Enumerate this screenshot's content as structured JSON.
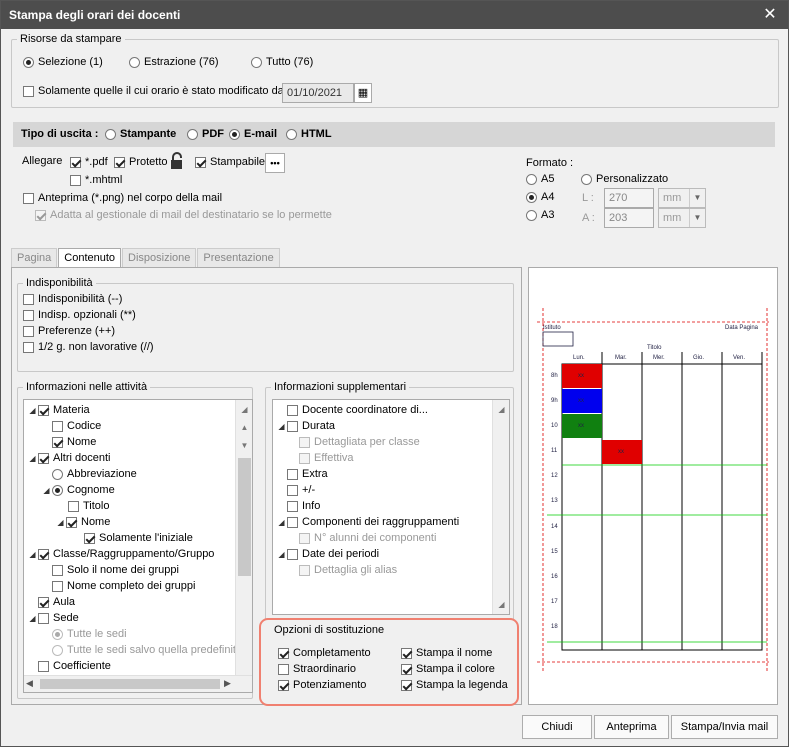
{
  "window": {
    "title": "Stampa degli orari dei docenti",
    "close": "✕"
  },
  "risorse": {
    "legend": "Risorse da stampare",
    "options": [
      {
        "label": "Selezione (1)",
        "selected": true
      },
      {
        "label": "Estrazione (76)",
        "selected": false
      },
      {
        "label": "Tutto (76)",
        "selected": false
      }
    ],
    "modified_label": "Solamente quelle il cui orario è stato modificato dal",
    "date": "01/10/2021"
  },
  "uscita": {
    "label": "Tipo di uscita :",
    "options": [
      {
        "label": "Stampante",
        "selected": false
      },
      {
        "label": "PDF",
        "selected": false
      },
      {
        "label": "E-mail",
        "selected": true
      },
      {
        "label": "HTML",
        "selected": false
      }
    ]
  },
  "allegare": {
    "label": "Allegare",
    "pdf": "*.pdf",
    "protetto": "Protetto",
    "stampabile": "Stampabile",
    "more": "•••",
    "mhtml": "*.mhtml",
    "anteprima": "Anteprima (*.png) nel corpo della mail",
    "adatta": "Adatta al gestionale di mail del destinatario se lo permette"
  },
  "formato": {
    "label": "Formato :",
    "a5": "A5",
    "a4": "A4",
    "a3": "A3",
    "personalizzato": "Personalizzato",
    "l_label": "L :",
    "a_label": "A :",
    "width": "270",
    "height": "203",
    "unit": "mm"
  },
  "tabs": [
    "Pagina",
    "Contenuto",
    "Disposizione",
    "Presentazione"
  ],
  "indisp": {
    "legend": "Indisponibilità",
    "items": [
      "Indisponibilità (--)",
      "Indisp. opzionali (**)",
      "Preferenze (++)",
      "1/2 g. non lavorative (//)"
    ]
  },
  "attivita": {
    "legend": "Informazioni nelle attività",
    "items": [
      "Materia",
      "Codice",
      "Nome",
      "Altri docenti",
      "Abbreviazione",
      "Cognome",
      "Titolo",
      "Nome",
      "Solamente l'iniziale",
      "Classe/Raggruppamento/Gruppo",
      "Solo il nome dei gruppi",
      "Nome completo dei gruppi",
      "Aula",
      "Sede",
      "Tutte le sedi",
      "Tutte le sedi salvo quella predefinita",
      "Coefficiente"
    ]
  },
  "supplementari": {
    "legend": "Informazioni supplementari",
    "items": [
      "Docente coordinatore di...",
      "Durata",
      "Dettagliata per classe",
      "Effettiva",
      "Extra",
      "+/-",
      "Info",
      "Componenti dei raggruppamenti",
      "N° alunni dei componenti",
      "Date dei periodi",
      "Dettaglia gli alias"
    ]
  },
  "sostituzione": {
    "legend": "Opzioni di sostituzione",
    "items": [
      "Completamento",
      "Straordinario",
      "Potenziamento",
      "Stampa il nome",
      "Stampa il colore",
      "Stampa la legenda"
    ]
  },
  "preview": {
    "istituto": "Istituto",
    "data": "Data Pagina",
    "titolo": "Titolo",
    "days": [
      "Lun.",
      "Mar.",
      "Mer.",
      "Gio.",
      "Ven."
    ],
    "hours": [
      "8h",
      "9h",
      "10",
      "11",
      "12",
      "13",
      "14",
      "15",
      "16",
      "17",
      "18"
    ],
    "cell": "xx",
    "colors": {
      "red": "#e00000",
      "blue": "#0000ee",
      "green": "#108010"
    }
  },
  "buttons": {
    "chiudi": "Chiudi",
    "anteprima": "Anteprima",
    "stampa": "Stampa/Invia mail"
  }
}
